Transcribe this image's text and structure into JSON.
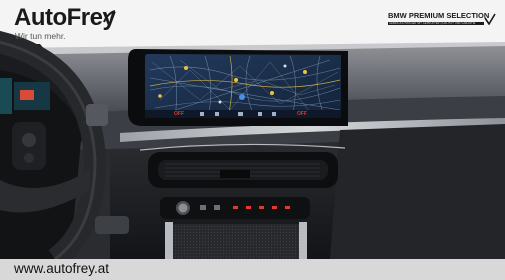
{
  "header": {
    "brand_name": "AutoFrey",
    "brand_tagline": "Wir tun mehr.",
    "partner_title": "BMW PREMIUM SELECTION",
    "partner_subtitle": "GEBRAUCHTWAGEN MIT GEPRÜFTER QUALITÄT UND GARANTIE"
  },
  "screen": {
    "left_status": "OFF",
    "right_status": "OFF"
  },
  "footer": {
    "url": "www.autofrey.at"
  },
  "colors": {
    "interior_dark": "#1c1d20",
    "screen_map": "#1f3350",
    "ambient_red": "#e23a2f",
    "footer_bg": "#d8d8d8"
  }
}
